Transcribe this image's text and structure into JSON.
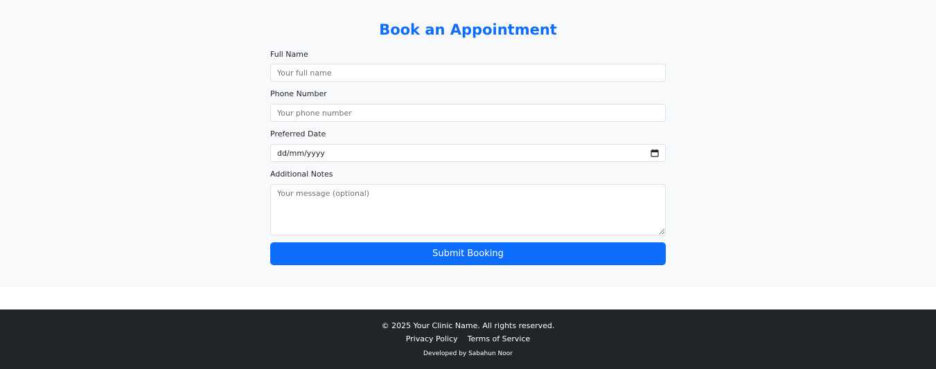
{
  "page": {
    "title": "Book an Appointment"
  },
  "form": {
    "full_name": {
      "label": "Full Name",
      "placeholder": "Your full name",
      "value": ""
    },
    "phone": {
      "label": "Phone Number",
      "placeholder": "Your phone number",
      "value": ""
    },
    "date": {
      "label": "Preferred Date",
      "display": "dd/mm/yyyy",
      "icon": "calendar-icon"
    },
    "notes": {
      "label": "Additional Notes",
      "placeholder": "Your message (optional)",
      "value": ""
    },
    "submit_label": "Submit Booking"
  },
  "footer": {
    "copyright": "© 2025 Your Clinic Name. All rights reserved.",
    "links": [
      {
        "label": "Privacy Policy"
      },
      {
        "label": "Terms of Service"
      }
    ],
    "developer_credit": "Developed by Sabahun Noor"
  },
  "colors": {
    "accent": "#0d6efd",
    "section_bg": "#f8f9fa",
    "footer_bg": "#212529",
    "border": "#dee2e6"
  }
}
